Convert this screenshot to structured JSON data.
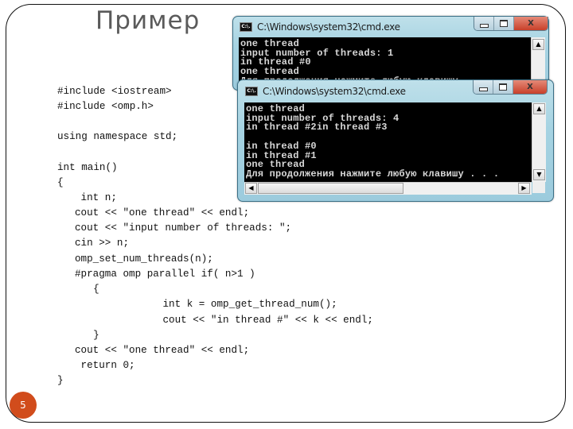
{
  "slide": {
    "title": "Пример",
    "page_number": "5"
  },
  "code": {
    "lines": [
      "#include <iostream>",
      "#include <omp.h>",
      "",
      "using namespace std;",
      "",
      "int main()",
      "{",
      " int n;",
      "cout << \"one thread\" << endl;",
      "cout << \"input number of threads: \";",
      "cin >> n;",
      "omp_set_num_threads(n);",
      "#pragma omp parallel if( n>1 )",
      "  {",
      "        int k = omp_get_thread_num();",
      "        cout << \"in thread #\" << k << endl;",
      "  }",
      "cout << \"one thread\" << endl;",
      " return 0;",
      "}"
    ]
  },
  "windows": [
    {
      "title": "C:\\Windows\\system32\\cmd.exe",
      "icon_label": "C:\\.",
      "buttons": {
        "minimize": "minimize",
        "maximize": "maximize",
        "close": "X"
      },
      "console_lines": [
        "one thread",
        "input number of threads: 1",
        "in thread #0",
        "one thread",
        "Для продолжения нажмите любую клавишу . . ."
      ]
    },
    {
      "title": "C:\\Windows\\system32\\cmd.exe",
      "icon_label": "C:\\.",
      "buttons": {
        "minimize": "minimize",
        "maximize": "maximize",
        "close": "X"
      },
      "console_lines": [
        "one thread",
        "input number of threads: 4",
        "in thread #2in thread #3",
        "",
        "in thread #0",
        "in thread #1",
        "one thread",
        "Для продолжения нажмите любую клавишу . . ."
      ]
    }
  ],
  "scroll_arrows": {
    "up": "▲",
    "down": "▼",
    "left": "◀",
    "right": "▶"
  },
  "colors": {
    "page_badge": "#d14c1c",
    "title": "#5a5a5a",
    "console_bg": "#000000",
    "console_text": "#d8d8d8",
    "close_button": "#c8402a"
  }
}
